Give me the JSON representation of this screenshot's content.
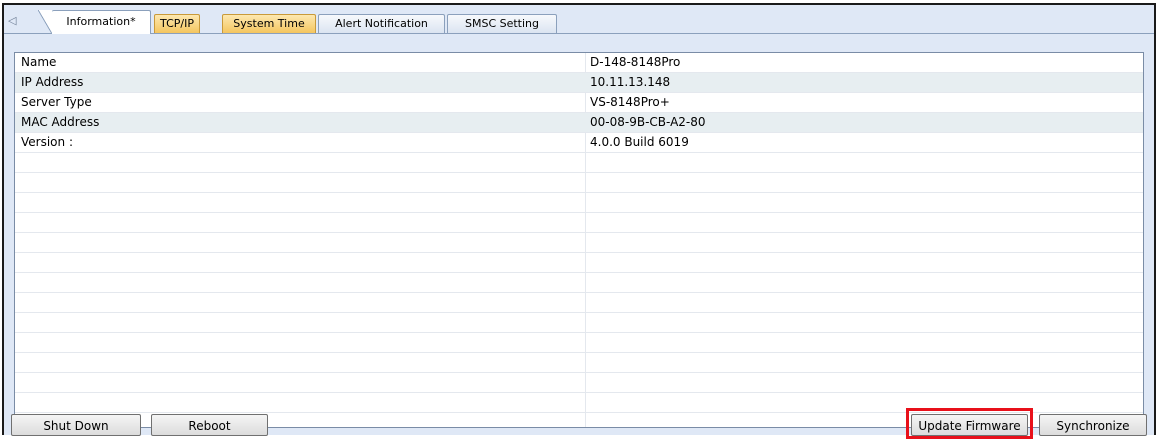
{
  "tabs": [
    {
      "label": "Information*",
      "active": true
    },
    {
      "label": "TCP/IP",
      "style": "orange"
    },
    {
      "label": "System Time",
      "style": "orange"
    },
    {
      "label": "Alert Notification"
    },
    {
      "label": "SMSC Setting"
    }
  ],
  "tab_scroll_icon": "◁",
  "info_rows": [
    {
      "name": "Name",
      "value": "D-148-8148Pro"
    },
    {
      "name": "IP Address",
      "value": "10.11.13.148"
    },
    {
      "name": "Server Type",
      "value": "VS-8148Pro+"
    },
    {
      "name": "MAC Address",
      "value": "00-08-9B-CB-A2-80"
    },
    {
      "name": "Version :",
      "value": "4.0.0 Build 6019"
    }
  ],
  "buttons": {
    "shut_down": "Shut Down",
    "reboot": "Reboot",
    "update_firmware": "Update Firmware",
    "synchronize": "Synchronize"
  },
  "colors": {
    "highlight": "#e8101a",
    "orange_tab": "#f4c55f",
    "panel_bg": "#dfe8f6"
  }
}
